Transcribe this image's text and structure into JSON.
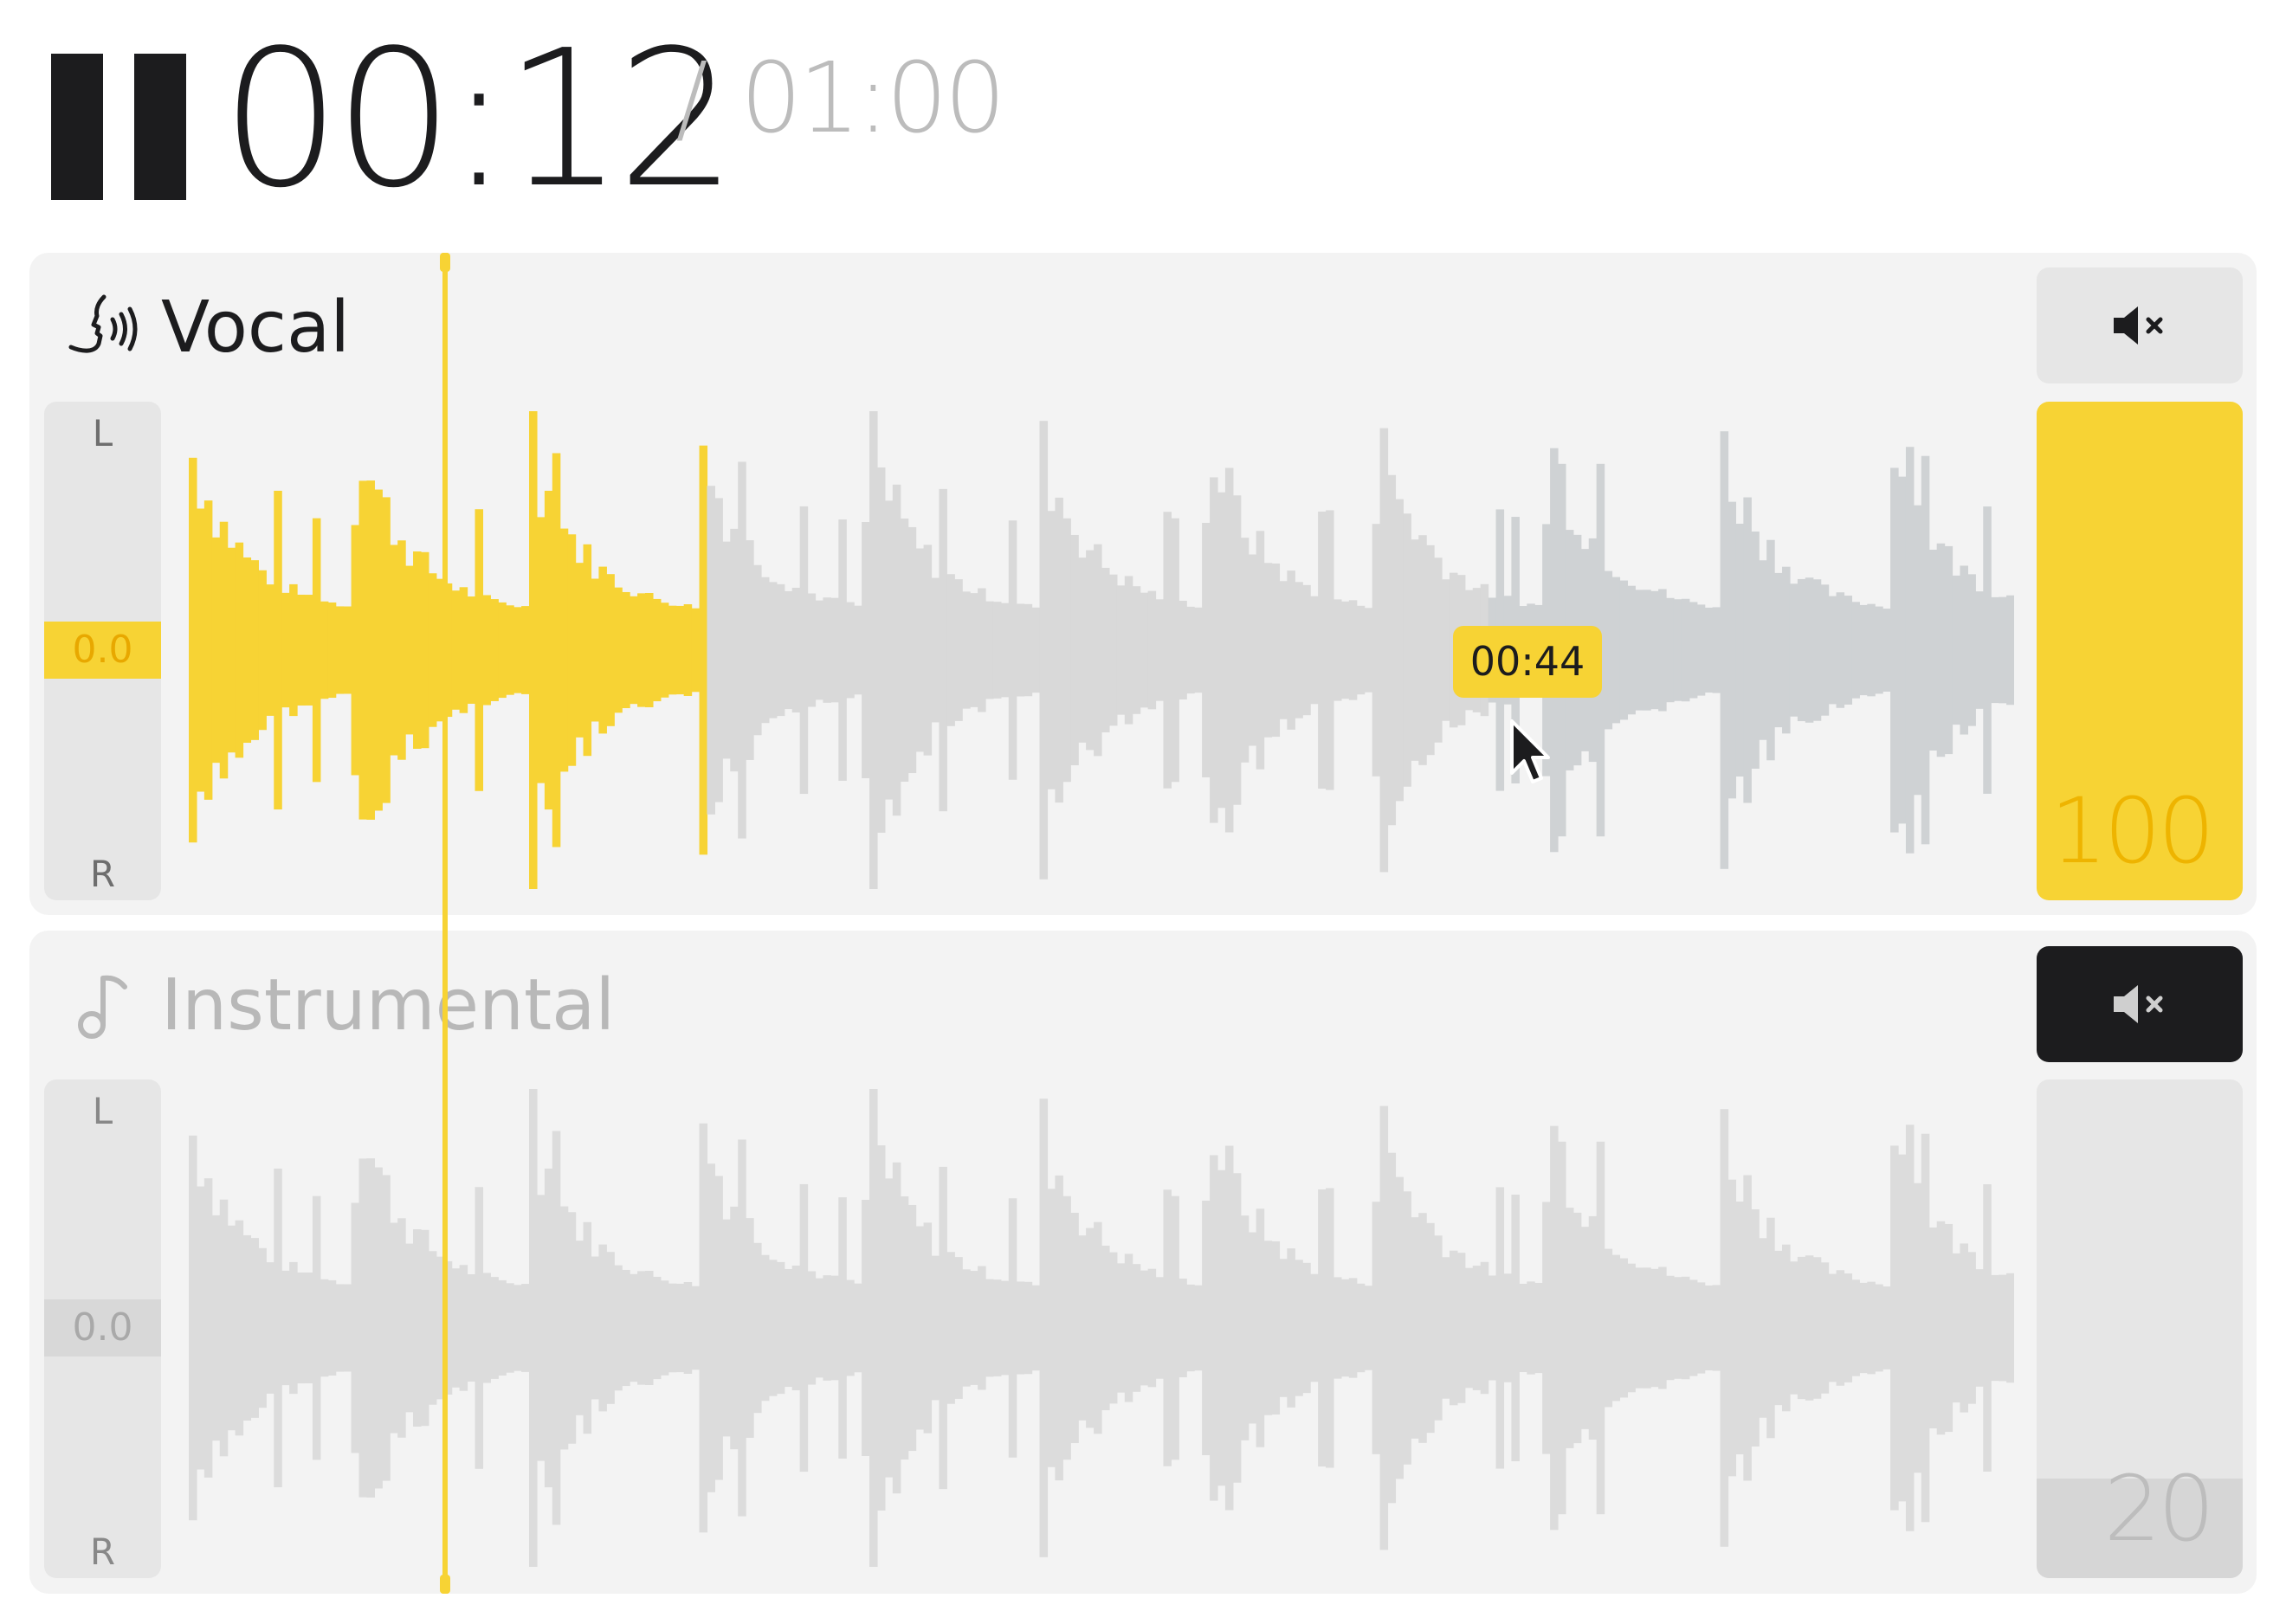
{
  "transport": {
    "state": "playing",
    "pause_icon": "pause-icon",
    "current_time": "00:12",
    "separator": "/",
    "total_time": "01:00"
  },
  "playhead": {
    "position_fraction": 0.2
  },
  "hover_tooltip": {
    "time": "00:44"
  },
  "colors": {
    "accent": "#f7d334",
    "accent_text": "#e8a800",
    "dark": "#1c1c1e",
    "track_bg": "#f3f3f3",
    "muted_text": "#b8b8b8"
  },
  "tracks": [
    {
      "name": "Vocal",
      "icon": "voice-icon",
      "muted": false,
      "pan": {
        "left_label": "L",
        "right_label": "R",
        "value": "0.0"
      },
      "volume": {
        "value": "100",
        "level": 1.0
      },
      "mute_icon": "mute-icon"
    },
    {
      "name": "Instrumental",
      "icon": "music-note-icon",
      "muted": true,
      "pan": {
        "left_label": "L",
        "right_label": "R",
        "value": "0.0"
      },
      "volume": {
        "value": "20",
        "level": 0.2
      },
      "mute_icon": "mute-icon"
    }
  ]
}
